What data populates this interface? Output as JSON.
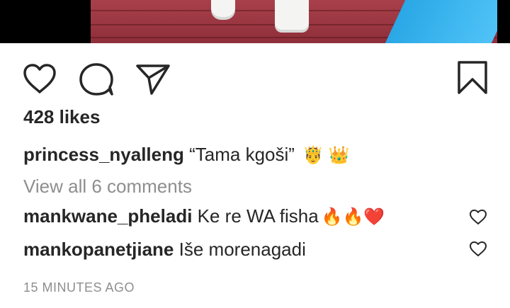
{
  "post": {
    "likes": "428 likes",
    "caption": {
      "username": "princess_nyalleng",
      "text": "“Tama kgoši” ",
      "emojis": "🤴 👑"
    },
    "view_all": "View all 6 comments",
    "comments": [
      {
        "username": "mankwane_pheladi",
        "text": "Ke re WA fisha",
        "emojis": "🔥🔥❤️"
      },
      {
        "username": "mankopanetjiane",
        "text": "Iše morenagadi",
        "emojis": ""
      }
    ],
    "timestamp": "15 MINUTES AGO"
  },
  "icons": {
    "like": "heart-outline-icon",
    "comment": "speech-bubble-icon",
    "share": "paper-plane-icon",
    "save": "bookmark-icon",
    "comment_like": "heart-outline-icon"
  },
  "colors": {
    "text": "#262626",
    "muted": "#8e8e8e"
  }
}
